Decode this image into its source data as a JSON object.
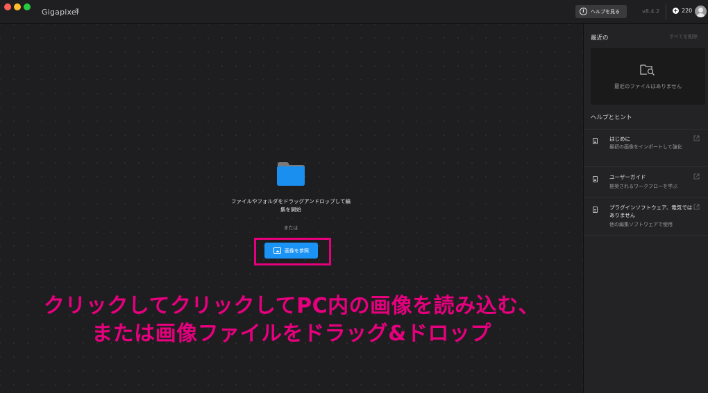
{
  "titlebar": {
    "app_name": "Gigapixel",
    "app_version_badge": "8",
    "help_button": "ヘルプを見る",
    "version": "v8.4.2",
    "credits": "220"
  },
  "main": {
    "drop_text": "ファイルやフォルダをドラッグアンドロップして編集を開始",
    "or_text": "または",
    "browse_button": "画像を参照"
  },
  "annotation": {
    "line1": "クリックしてクリックしてPC内の画像を読み込む、",
    "line2": "または画像ファイルをドラッグ&ドロップ"
  },
  "sidebar": {
    "recent_title": "最近の",
    "clear_all": "すべてを削除",
    "recent_empty": "最近のファイルはありません",
    "help_title": "ヘルプとヒント",
    "items": [
      {
        "title": "はじめに",
        "description": "最初の画像をインポートして強化"
      },
      {
        "title": "ユーザーガイド",
        "description": "推奨されるワークフローを学ぶ"
      },
      {
        "title": "プラグインソフトウェア、電気ではありません",
        "description": "他の編集ソフトウェアで使用"
      }
    ]
  },
  "colors": {
    "accent_blue": "#1b93f5",
    "annotation_magenta": "#e6007e",
    "folder_blue": "#1a8ff0"
  }
}
